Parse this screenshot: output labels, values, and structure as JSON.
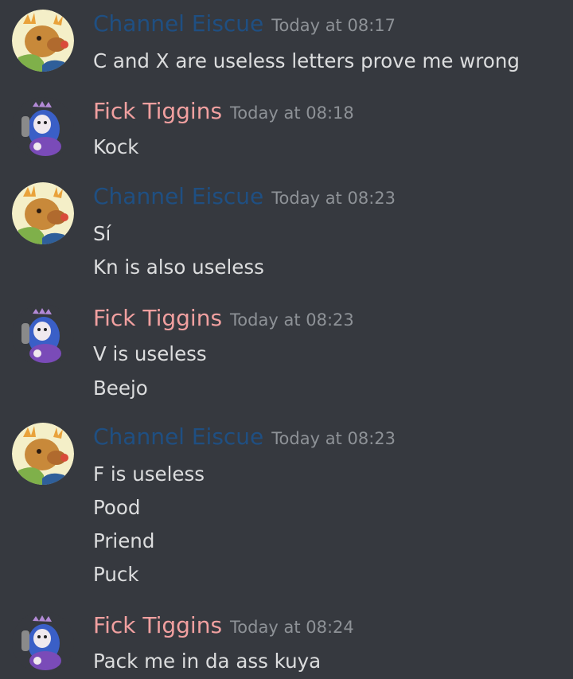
{
  "colors": {
    "background": "#36393f",
    "channel_eiscue_name": "#1f4f82",
    "fick_tiggins_name": "#f1a0a0",
    "timestamp": "#8e9297",
    "message_text": "#dcddde"
  },
  "messages": [
    {
      "author": "Channel Eiscue",
      "timestamp": "Today at 08:17",
      "avatar_icon": "deer-avatar-icon",
      "lines": [
        "C and X are useless letters prove me wrong"
      ]
    },
    {
      "author": "Fick Tiggins",
      "timestamp": "Today at 08:18",
      "avatar_icon": "character-avatar-icon",
      "lines": [
        "Kock"
      ]
    },
    {
      "author": "Channel Eiscue",
      "timestamp": "Today at 08:23",
      "avatar_icon": "deer-avatar-icon",
      "lines": [
        "Sí",
        "Kn is also useless"
      ]
    },
    {
      "author": "Fick Tiggins",
      "timestamp": "Today at 08:23",
      "avatar_icon": "character-avatar-icon",
      "lines": [
        "V is useless",
        "Beejo"
      ]
    },
    {
      "author": "Channel Eiscue",
      "timestamp": "Today at 08:23",
      "avatar_icon": "deer-avatar-icon",
      "lines": [
        "F is useless",
        "Pood",
        "Priend",
        "Puck"
      ]
    },
    {
      "author": "Fick Tiggins",
      "timestamp": "Today at 08:24",
      "avatar_icon": "character-avatar-icon",
      "lines": [
        "Pack me in da ass kuya"
      ]
    }
  ]
}
